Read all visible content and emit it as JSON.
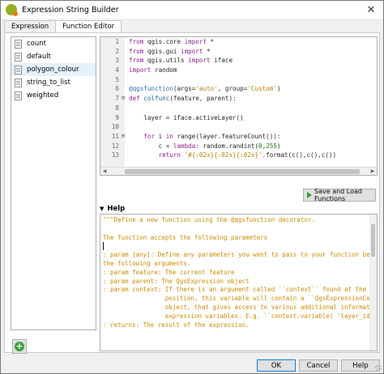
{
  "window": {
    "title": "Expression String Builder",
    "close_glyph": "✕"
  },
  "tabs": [
    {
      "label": "Expression"
    },
    {
      "label": "Function Editor"
    }
  ],
  "functions": [
    {
      "label": "count"
    },
    {
      "label": "default"
    },
    {
      "label": "polygon_colour"
    },
    {
      "label": "string_to_list"
    },
    {
      "label": "weighted"
    }
  ],
  "selected_function": "polygon_colour",
  "code_lines": [
    "from qgis.core import *",
    "from qgis.gui import *",
    "from qgis.utils import iface",
    "import random",
    "",
    "@qgsfunction(args='auto', group='Custom')",
    "def colfunc(feature, parent):",
    "",
    "    layer = iface.activeLayer()",
    "",
    "    for i in range(layer.featureCount()):",
    "        c = lambda: random.randint(0,255)",
    "        return '#{:02x}{:02x}{:02x}'.format(c(),c(),c())"
  ],
  "save_button": {
    "label": "Save and Load Functions"
  },
  "help": {
    "title": "Help",
    "lines": [
      "\"\"\"Define a new function using the @qgsfunction decorator.",
      "",
      "The function accepts the following parameters",
      "",
      ": param [any]: Define any parameters you want to pass to your function befor",
      "the following arguments.",
      ": param feature: The current feature",
      ": param parent: The QgsExpression object",
      ": param context: If there is an argument called ``context`` found at the las",
      "                 position, this variable will contain a ``QgsExpressionCont",
      "                 object, that gives access to various additional informatio",
      "                 expression variables. E.g. ``context.variable( 'layer_id'",
      ": returns: The result of the expression."
    ]
  },
  "buttons": {
    "ok": "OK",
    "cancel": "Cancel",
    "help": "Help"
  },
  "colors": {
    "accent": "#0078d7",
    "help_text": "#c98a00",
    "selection": "#e5f1fb"
  }
}
